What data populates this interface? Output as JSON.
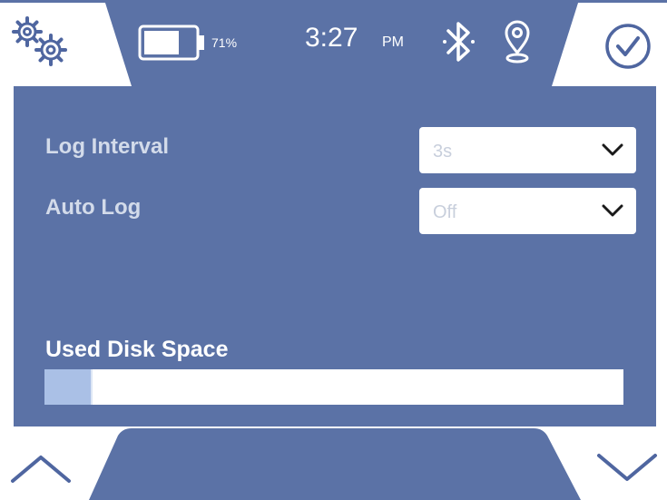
{
  "status_bar": {
    "battery_percent_label": "71%",
    "battery_level": 0.71,
    "time": "3:27",
    "ampm": "PM",
    "icons": [
      "gears-icon",
      "battery-icon",
      "bluetooth-icon",
      "location-pin-icon",
      "check-circle-icon"
    ]
  },
  "settings": {
    "log_interval": {
      "label": "Log Interval",
      "value": "3s"
    },
    "auto_log": {
      "label": "Auto Log",
      "value": "Off"
    }
  },
  "disk": {
    "label": "Used Disk Space",
    "used_fraction": 0.08
  },
  "footer": {
    "icons": [
      "chevron-up-icon",
      "chevron-down-icon"
    ]
  },
  "colors": {
    "panel": "#5b72a6",
    "border": "#4f66a0",
    "progress_fill": "#aac0e6",
    "label_muted": "#d3dbea"
  }
}
